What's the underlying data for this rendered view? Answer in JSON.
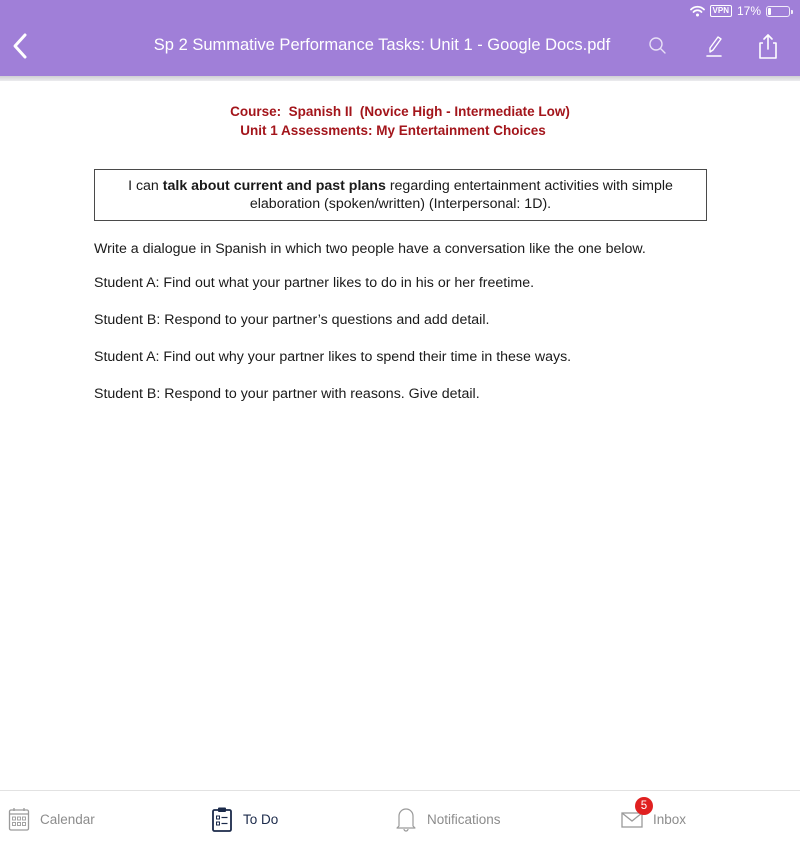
{
  "status_bar": {
    "vpn_label": "VPN",
    "battery_text": "17%",
    "battery_level": 0.17,
    "icons": [
      "wifi-icon",
      "vpn-icon",
      "battery-icon"
    ]
  },
  "header": {
    "title": "Sp 2 Summative Performance Tasks: Unit 1 - Google Docs.pdf",
    "back_icon": "chevron-left-icon",
    "actions": [
      {
        "name": "search",
        "icon": "search-icon"
      },
      {
        "name": "markup",
        "icon": "pen-icon"
      },
      {
        "name": "share",
        "icon": "share-icon"
      }
    ],
    "background_color": "#a07fd8"
  },
  "document": {
    "course_line": "Course:  Spanish II  (Novice High - Intermediate Low)",
    "unit_line": "Unit 1 Assessments: My Entertainment Choices",
    "heading_color": "#a3151b",
    "goal": {
      "prefix": "I can ",
      "bold": "talk about current and past plans",
      "suffix": " regarding entertainment activities with simple elaboration (spoken/written) (Interpersonal: 1D)."
    },
    "paragraphs": [
      "Write a dialogue in Spanish in which two people have a conversation like the one below.",
      "Student A: Find out what your partner likes to do in his or her freetime.",
      "Student B: Respond to your partner’s questions and add detail.",
      "Student A: Find out why your partner likes to spend their time in these ways.",
      "Student B: Respond to your partner with reasons. Give detail."
    ]
  },
  "tabbar": {
    "tabs": [
      {
        "label": "Calendar",
        "icon": "calendar-icon",
        "active": false
      },
      {
        "label": "To Do",
        "icon": "clipboard-icon",
        "active": true
      },
      {
        "label": "Notifications",
        "icon": "bell-icon",
        "active": false
      },
      {
        "label": "Inbox",
        "icon": "envelope-icon",
        "active": false,
        "badge": "5"
      }
    ],
    "active_color": "#1b2a4a",
    "inactive_color": "#8c8c8c",
    "badge_color": "#e02020"
  }
}
